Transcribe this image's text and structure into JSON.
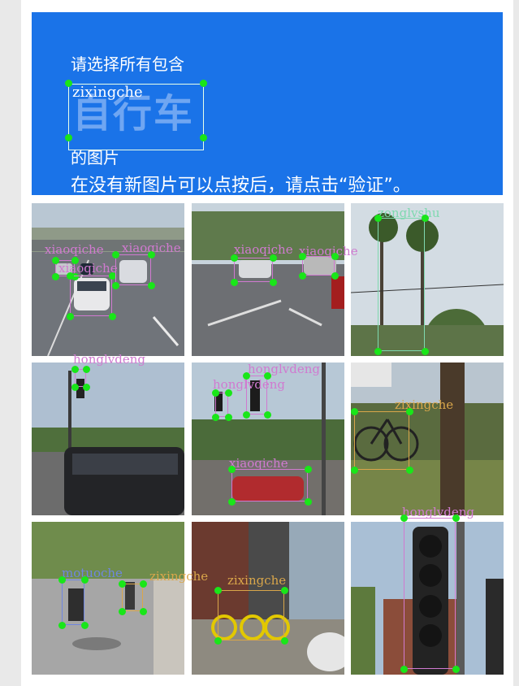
{
  "captcha": {
    "instruction_line1": "请选择所有包含",
    "keyword_label": "zixingche",
    "keyword": "自行车",
    "instruction_line3": "的图片",
    "instruction_line4": "在没有新图片可以点按后，请点击“验证”。",
    "colors": {
      "header": "#1a73e8",
      "dot": "#19e619",
      "label_purple": "#d07ad0",
      "label_teal": "#7fd9b0",
      "label_orange": "#d9a64a",
      "label_blue": "#6f86e0"
    },
    "tiles": [
      {
        "name": "tile-highway-cars",
        "scene": "highway"
      },
      {
        "name": "tile-street-cars",
        "scene": "street"
      },
      {
        "name": "tile-palm-trees",
        "scene": "palms"
      },
      {
        "name": "tile-traffic-light-van",
        "scene": "van"
      },
      {
        "name": "tile-intersection-lights",
        "scene": "intersection"
      },
      {
        "name": "tile-parked-bicycle",
        "scene": "bicycle"
      },
      {
        "name": "tile-cyclists-road",
        "scene": "cyclists"
      },
      {
        "name": "tile-yellow-bikes",
        "scene": "yellowbikes"
      },
      {
        "name": "tile-traffic-signal-closeup",
        "scene": "signal"
      }
    ],
    "annotations": [
      {
        "label": "xiaoqiche",
        "color": "#d07ad0"
      },
      {
        "label": "xiaoqiche",
        "color": "#d07ad0"
      },
      {
        "label": "xiaoqiche",
        "color": "#d07ad0"
      },
      {
        "label": "xiaoqiche",
        "color": "#d07ad0"
      },
      {
        "label": "xiaoqiche",
        "color": "#d07ad0"
      },
      {
        "label": "zonglvshu",
        "color": "#7fd9b0"
      },
      {
        "label": "honglvdeng",
        "color": "#d07ad0"
      },
      {
        "label": "honglvdeng",
        "color": "#d07ad0"
      },
      {
        "label": "honglvdeng",
        "color": "#d07ad0"
      },
      {
        "label": "xiaoqiche",
        "color": "#d07ad0"
      },
      {
        "label": "zixingche",
        "color": "#d9a64a"
      },
      {
        "label": "motuoche",
        "color": "#6f86e0"
      },
      {
        "label": "zixingche",
        "color": "#d9a64a"
      },
      {
        "label": "zixingche",
        "color": "#d9a64a"
      },
      {
        "label": "honglvdeng",
        "color": "#d07ad0"
      }
    ]
  }
}
